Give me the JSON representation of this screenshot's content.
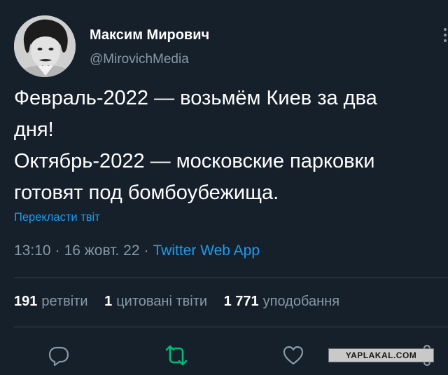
{
  "author": {
    "display_name": "Максим Мирович",
    "handle": "@MirovichMedia",
    "avatar_icon": "profile-photo"
  },
  "tweet": {
    "text": "Февраль-2022 — возьмём Киев за два\nдня!\nОктябрь-2022 — московские парковки\nготовят под бомбоубежища.",
    "translate_link": "Перекласти твіт",
    "time": "13:10",
    "date": "16 жовт. 22",
    "separator": "·",
    "source": "Twitter Web App"
  },
  "stats": [
    {
      "count": "191",
      "label": "ретвіти"
    },
    {
      "count": "1",
      "label": "цитовані твіти"
    },
    {
      "count": "1 771",
      "label": "уподобання"
    }
  ],
  "actions": [
    "reply-icon",
    "retweet-icon",
    "like-icon",
    "share-icon"
  ],
  "watermark": "YAPLAKAL.COM",
  "colors": {
    "background": "#15202b",
    "text": "#ffffff",
    "secondary": "#8899a6",
    "link": "#1d9bf0",
    "retweet_accent": "#00ba7c",
    "divider": "#38444d"
  }
}
